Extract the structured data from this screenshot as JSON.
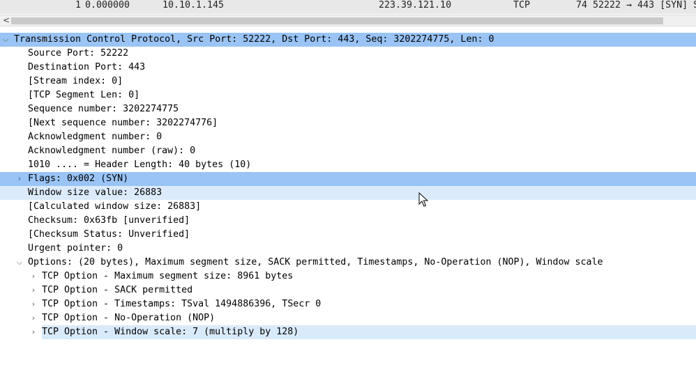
{
  "packet_list": {
    "row": {
      "no": "1",
      "time": "0.000000",
      "source": "10.10.1.145",
      "destination": "223.39.121.10",
      "protocol": "TCP",
      "info": "74 52222 → 443 [SYN] S"
    }
  },
  "details": {
    "tcp_header": "Transmission Control Protocol, Src Port: 52222, Dst Port: 443, Seq: 3202274775, Len: 0",
    "fields": [
      "Source Port: 52222",
      "Destination Port: 443",
      "[Stream index: 0]",
      "[TCP Segment Len: 0]",
      "Sequence number: 3202274775",
      "[Next sequence number: 3202274776]",
      "Acknowledgment number: 0",
      "Acknowledgment number (raw): 0",
      "1010 .... = Header Length: 40 bytes (10)"
    ],
    "flags": "Flags: 0x002 (SYN)",
    "fields2": [
      "Window size value: 26883",
      "[Calculated window size: 26883]",
      "Checksum: 0x63fb [unverified]",
      "[Checksum Status: Unverified]",
      "Urgent pointer: 0"
    ],
    "options": "Options: (20 bytes), Maximum segment size, SACK permitted, Timestamps, No-Operation (NOP), Window scale",
    "option_items": [
      "TCP Option - Maximum segment size: 8961 bytes",
      "TCP Option - SACK permitted",
      "TCP Option - Timestamps: TSval 1494886396, TSecr 0",
      "TCP Option - No-Operation (NOP)",
      "TCP Option - Window scale: 7 (multiply by 128)"
    ]
  },
  "icons": {
    "expanded": "chevron-down-icon",
    "collapsed": "chevron-right-icon",
    "scroll_left": "arrow-left-icon",
    "cursor": "mouse-pointer-icon"
  },
  "colors": {
    "selected": "#99c4f5",
    "related": "#d9eafa",
    "packet_row": "#e8e8e8"
  }
}
